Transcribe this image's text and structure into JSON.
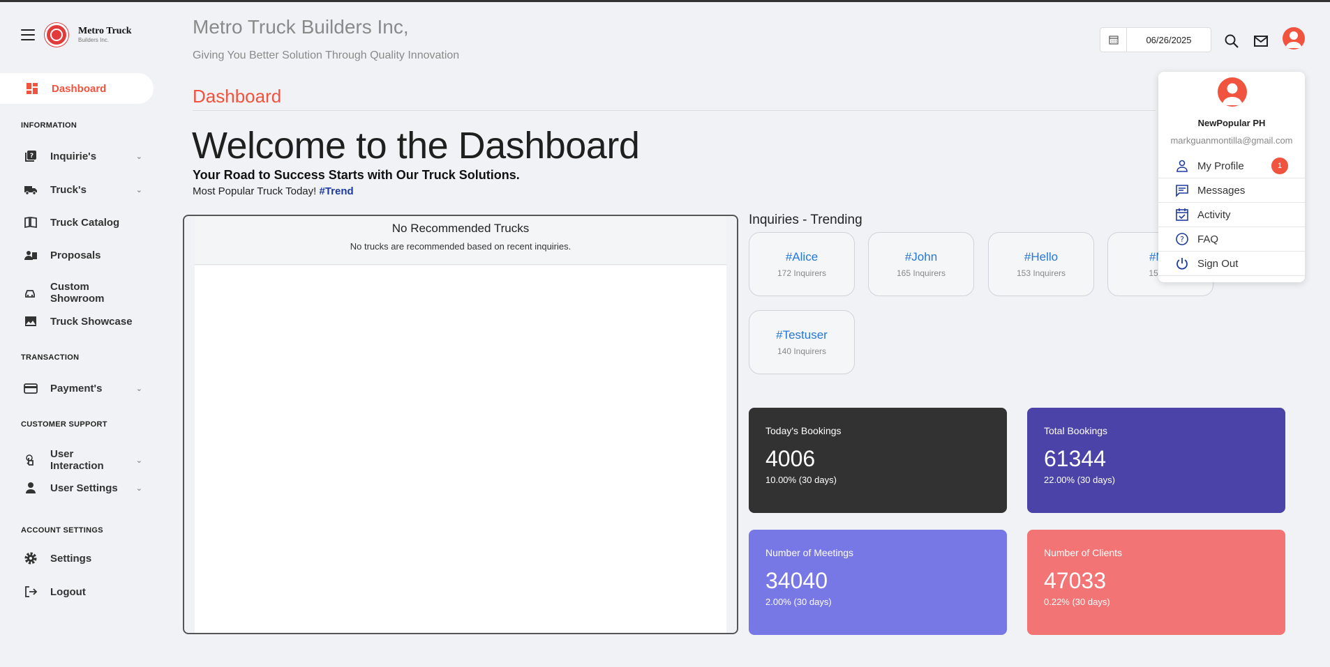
{
  "brand": {
    "name": "Metro Truck",
    "sub": "Builders Inc."
  },
  "header": {
    "company": "Metro Truck Builders Inc,",
    "tagline": "Giving You Better Solution Through Quality Innovation",
    "date": "06/26/2025"
  },
  "sidebar": {
    "active": "Dashboard",
    "sections": {
      "information": "INFORMATION",
      "transaction": "TRANSACTION",
      "support": "CUSTOMER SUPPORT",
      "account": "ACCOUNT SETTINGS"
    },
    "items": {
      "inquiries": "Inquirie's",
      "trucks": "Truck's",
      "catalog": "Truck Catalog",
      "proposals": "Proposals",
      "showroom": "Custom Showroom",
      "showcase": "Truck Showcase",
      "payments": "Payment's",
      "interaction": "User Interaction",
      "user_settings": "User Settings",
      "settings": "Settings",
      "logout": "Logout"
    }
  },
  "main": {
    "page_title": "Dashboard",
    "welcome": "Welcome to the Dashboard",
    "subtitle": "Your Road to Success Starts with Our Truck Solutions.",
    "popular_prefix": "Most Popular Truck Today!",
    "popular_tag": "#Trend"
  },
  "recommended": {
    "title": "No Recommended Trucks",
    "message": "No trucks are recommended based on recent inquiries."
  },
  "trending": {
    "title": "Inquiries - Trending",
    "tags": [
      {
        "name": "#Alice",
        "count": "172 Inquirers"
      },
      {
        "name": "#John",
        "count": "165 Inquirers"
      },
      {
        "name": "#Hello",
        "count": "153 Inquirers"
      },
      {
        "name": "#My",
        "count": "153 In"
      },
      {
        "name": "#Testuser",
        "count": "140 Inquirers"
      }
    ]
  },
  "stats": [
    {
      "label": "Today's Bookings",
      "value": "4006",
      "change": "10.00% (30 days)",
      "color": "#323232"
    },
    {
      "label": "Total Bookings",
      "value": "61344",
      "change": "22.00% (30 days)",
      "color": "#4b43a8"
    },
    {
      "label": "Number of Meetings",
      "value": "34040",
      "change": "2.00% (30 days)",
      "color": "#7877e6"
    },
    {
      "label": "Number of Clients",
      "value": "47033",
      "change": "0.22% (30 days)",
      "color": "#f27474"
    }
  ],
  "profile_menu": {
    "name": "NewPopular PH",
    "email": "markguanmontilla@gmail.com",
    "items": {
      "profile": "My Profile",
      "profile_badge": "1",
      "messages": "Messages",
      "activity": "Activity",
      "faq": "FAQ",
      "signout": "Sign Out"
    }
  },
  "colors": {
    "accent": "#f0533e",
    "link": "#2677d6",
    "trend": "#1e3a9e"
  }
}
